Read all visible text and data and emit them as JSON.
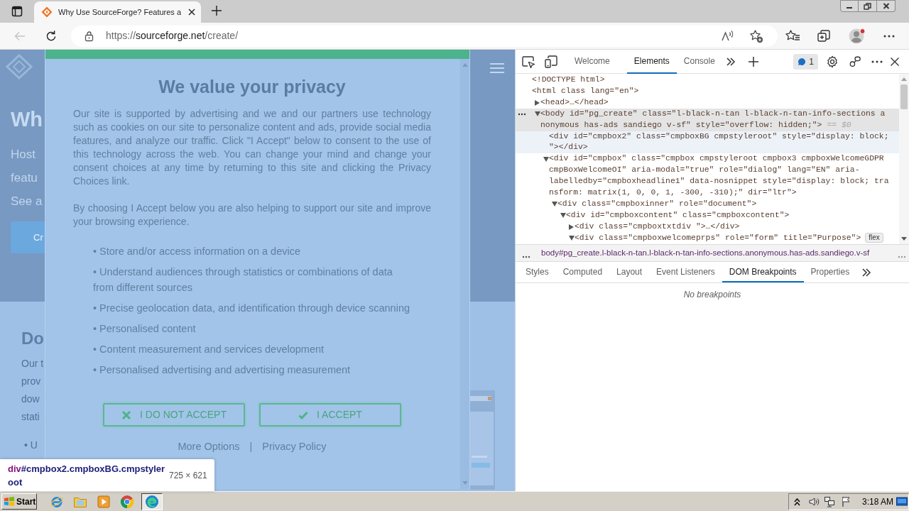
{
  "browser": {
    "tabs": [
      {
        "title": "Why Use SourceForge? Features a",
        "selected": true
      }
    ],
    "toolbar": {
      "back": {
        "disabled": true
      },
      "url": {
        "scheme": "https://",
        "host": "sourceforge.net",
        "path": "/create/"
      }
    }
  },
  "page": {
    "hero": {
      "heading": "Wh",
      "lines": [
        "Host",
        "featu",
        "See a"
      ],
      "button": "Cr"
    },
    "section": {
      "heading": "Do",
      "lines": [
        "Our t",
        "prov",
        "dow",
        "stati"
      ],
      "bullets": [
        "• U"
      ]
    }
  },
  "consent_dialog": {
    "title": "We value your privacy",
    "paragraphs": [
      "Our site is supported by advertising and we and our partners use technology such as cookies on our site to personalize content and ads, provide social media features, and analyze our traffic. Click \"I Accept\" below to consent to the use of this technology across the web. You can change your mind and change your consent choices at any time by returning to this site and clicking the Privacy Choices link.",
      "By choosing I Accept below you are also helping to support our site and improve your browsing experience."
    ],
    "purposes": [
      "• Store and/or access information on a device",
      "• Understand audiences through statistics or combinations of data from different sources",
      "• Precise geolocation data, and identification through device scanning",
      "• Personalised content",
      "• Content measurement and services development",
      "• Personalised advertising and advertising measurement"
    ],
    "buttons": [
      {
        "kind": "reject",
        "label": "I DO NOT ACCEPT"
      },
      {
        "kind": "accept",
        "label": "I ACCEPT"
      }
    ],
    "links": [
      "More Options",
      "Privacy Policy"
    ],
    "link_separator": "|"
  },
  "inspect_tooltip": {
    "tag": "div",
    "selector": "#cmpbox2.cmpboxBG.cmpstyleroot",
    "size": "725 × 621"
  },
  "devtools": {
    "tabs": [
      {
        "label": "Welcome",
        "selected": false
      },
      {
        "label": "Elements",
        "selected": true
      },
      {
        "label": "Console",
        "selected": false
      }
    ],
    "issues": "1",
    "dom_tree": [
      {
        "lines": [
          "<!DOCTYPE html>"
        ],
        "selected": false,
        "hovered": false
      },
      {
        "lines": [
          "<html class lang=\"en\">"
        ],
        "selected": false,
        "hovered": false,
        "children": [
          {
            "lines": [
              "<head>…</head>"
            ],
            "expanded": false,
            "selected": false,
            "hovered": false
          },
          {
            "lines": [
              "<body id=\"pg_create\" class=\"l-black-n-tan l-black-n-tan-info-sections a",
              "nonymous has-ads sandiego v-sf\" style=\"overflow: hidden;\">"
            ],
            "note": "== $0",
            "expanded": true,
            "selected": true,
            "hovered": false,
            "children": [
              {
                "lines": [
                  "<div id=\"cmpbox2\" class=\"cmpboxBG cmpstyleroot\" style=\"display: block;",
                  "\"></div>"
                ],
                "selected": false,
                "hovered": true
              },
              {
                "lines": [
                  "<div id=\"cmpbox\" class=\"cmpbox cmpstyleroot cmpbox3 cmpboxWelcomeGDPR",
                  "cmpBoxWelcomeOI\" aria-modal=\"true\" role=\"dialog\" lang=\"EN\" aria-",
                  "labelledby=\"cmpboxheadline1\" data-nosnippet style=\"display: block; tra",
                  "nsform: matrix(1, 0, 0, 1, -300, -310);\" dir=\"ltr\">"
                ],
                "expanded": true,
                "selected": false,
                "hovered": false,
                "children": [
                  {
                    "lines": [
                      "<div class=\"cmpboxinner\" role=\"document\">"
                    ],
                    "expanded": true,
                    "selected": false,
                    "hovered": false,
                    "children": [
                      {
                        "lines": [
                          "<div id=\"cmpboxcontent\" class=\"cmpboxcontent\">"
                        ],
                        "expanded": true,
                        "selected": false,
                        "hovered": false,
                        "children": [
                          {
                            "lines": [
                              "<div class=\"cmpboxtxtdiv \">…</div>"
                            ],
                            "expanded": false,
                            "selected": false,
                            "hovered": false
                          },
                          {
                            "lines": [
                              "<div class=\"cmpboxwelcomeprps\" role=\"form\" title=\"Purpose\">"
                            ],
                            "badge": "flex",
                            "expanded": true,
                            "selected": false,
                            "hovered": false
                          }
                        ]
                      }
                    ]
                  }
                ]
              }
            ]
          }
        ]
      }
    ],
    "breadcrumb": "body#pg_create.l-black-n-tan.l-black-n-tan-info-sections.anonymous.has-ads.sandiego.v-sf",
    "panel_tabs": [
      {
        "label": "Styles",
        "selected": false
      },
      {
        "label": "Computed",
        "selected": false
      },
      {
        "label": "Layout",
        "selected": false
      },
      {
        "label": "Event Listeners",
        "selected": false
      },
      {
        "label": "DOM Breakpoints",
        "selected": true
      },
      {
        "label": "Properties",
        "selected": false
      }
    ],
    "empty_message": "No breakpoints"
  },
  "taskbar": {
    "start": "Start",
    "apps": [
      {
        "kind": "ie",
        "selected": false
      },
      {
        "kind": "folder",
        "selected": false
      },
      {
        "kind": "media",
        "selected": false
      },
      {
        "kind": "chrome",
        "selected": false
      },
      {
        "kind": "edge",
        "selected": true
      }
    ],
    "clock": "3:18 AM"
  }
}
